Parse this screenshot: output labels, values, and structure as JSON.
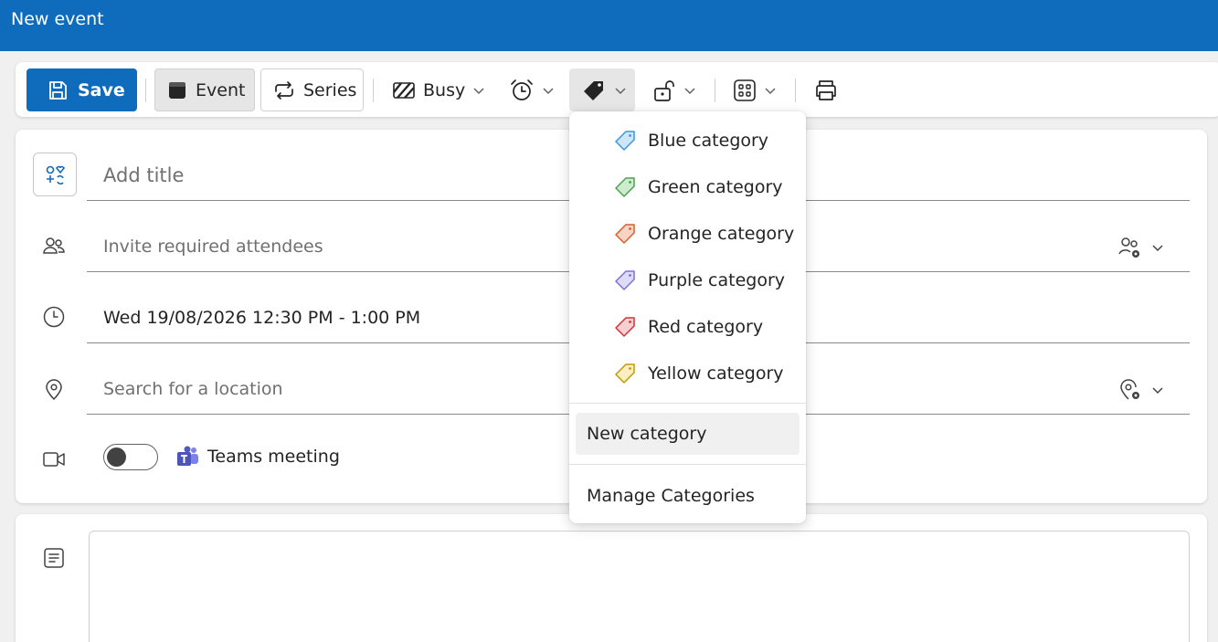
{
  "window": {
    "title": "New event"
  },
  "toolbar": {
    "save_label": "Save",
    "event_label": "Event",
    "series_label": "Series",
    "busy_label": "Busy"
  },
  "form": {
    "title_placeholder": "Add title",
    "attendees_placeholder": "Invite required attendees",
    "datetime": "Wed 19/08/2026 12:30 PM - 1:00 PM",
    "location_placeholder": "Search for a location",
    "teams_label": "Teams meeting"
  },
  "category_menu": {
    "items": [
      {
        "label": "Blue category",
        "color": "#3a96dd",
        "fill": "#cfe6f8"
      },
      {
        "label": "Green category",
        "color": "#4ea04e",
        "fill": "#cdeccd"
      },
      {
        "label": "Orange category",
        "color": "#d4602a",
        "fill": "#f8d4c4"
      },
      {
        "label": "Purple category",
        "color": "#7a73d4",
        "fill": "#dedaf7"
      },
      {
        "label": "Red category",
        "color": "#d13438",
        "fill": "#f6cfd0"
      },
      {
        "label": "Yellow category",
        "color": "#c19c00",
        "fill": "#fbeec2"
      }
    ],
    "new_category": "New category",
    "manage_categories": "Manage Categories"
  },
  "colors": {
    "accent": "#0f6cbd"
  }
}
